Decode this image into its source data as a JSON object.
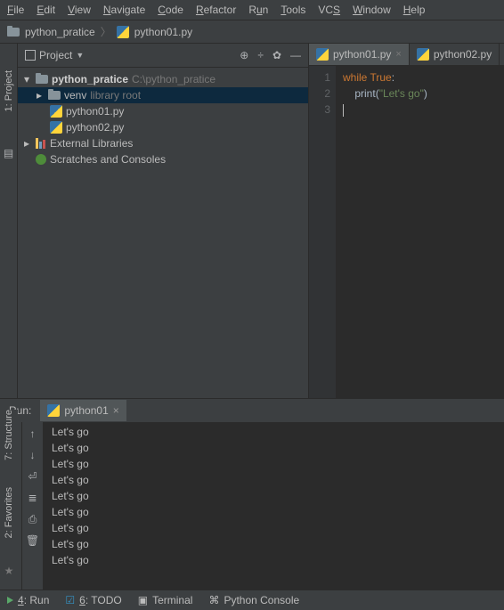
{
  "menu": {
    "file": "File",
    "edit": "Edit",
    "view": "View",
    "navigate": "Navigate",
    "code": "Code",
    "refactor": "Refactor",
    "run": "Run",
    "tools": "Tools",
    "vcs": "VCS",
    "window": "Window",
    "help": "Help"
  },
  "breadcrumb": {
    "folder": "python_pratice",
    "file": "python01.py"
  },
  "left_tools": {
    "project": "1: Project",
    "structure": "7: Structure",
    "favorites": "2: Favorites"
  },
  "project_panel": {
    "title": "Project",
    "tree": {
      "root": "python_pratice",
      "root_path": "C:\\python_pratice",
      "venv": "venv",
      "venv_hint": "library root",
      "file1": "python01.py",
      "file2": "python02.py",
      "ext_lib": "External Libraries",
      "scratches": "Scratches and Consoles"
    }
  },
  "editor": {
    "tabs": {
      "t1": "python01.py",
      "t2": "python02.py"
    },
    "gutter": {
      "l1": "1",
      "l2": "2",
      "l3": "3"
    },
    "code": {
      "kw_while": "while",
      "kw_true": "True",
      "colon": ":",
      "fn_print": "print",
      "paren_open": "(",
      "str": "\"Let's go\"",
      "paren_close": ")"
    }
  },
  "run": {
    "label": "Run:",
    "tab": "python01",
    "output_line": "Let's go"
  },
  "statusbar": {
    "run": "4: Run",
    "todo": "6: TODO",
    "terminal": "Terminal",
    "console": "Python Console"
  }
}
